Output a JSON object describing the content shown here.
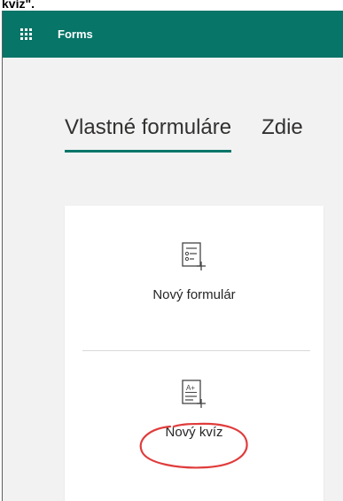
{
  "caption": "kvíz\".",
  "header": {
    "app_name": "Forms"
  },
  "tabs": [
    {
      "label": "Vlastné formuláre",
      "active": true
    },
    {
      "label": "Zdie",
      "active": false
    }
  ],
  "options": [
    {
      "label": "Nový formulár",
      "icon": "form-icon"
    },
    {
      "label": "Nový kvíz",
      "icon": "quiz-icon"
    }
  ],
  "quiz_icon_text": "A+",
  "colors": {
    "brand": "#077568",
    "annotation": "#e03c3c"
  }
}
